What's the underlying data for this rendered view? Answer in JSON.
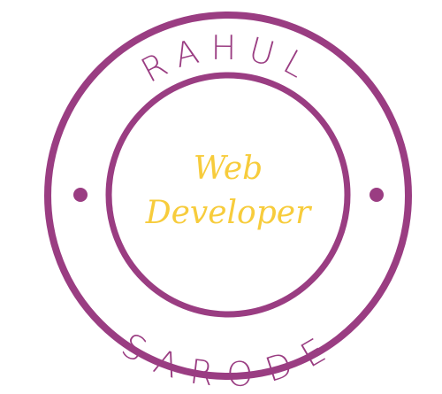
{
  "logo": {
    "top_text": "RAHUL",
    "bottom_text": "SARODE",
    "center_line1": "Web",
    "center_line2": "Developer"
  },
  "colors": {
    "ring": "#9a3d82",
    "script": "#f7cc3c",
    "background": "#ffffff"
  }
}
